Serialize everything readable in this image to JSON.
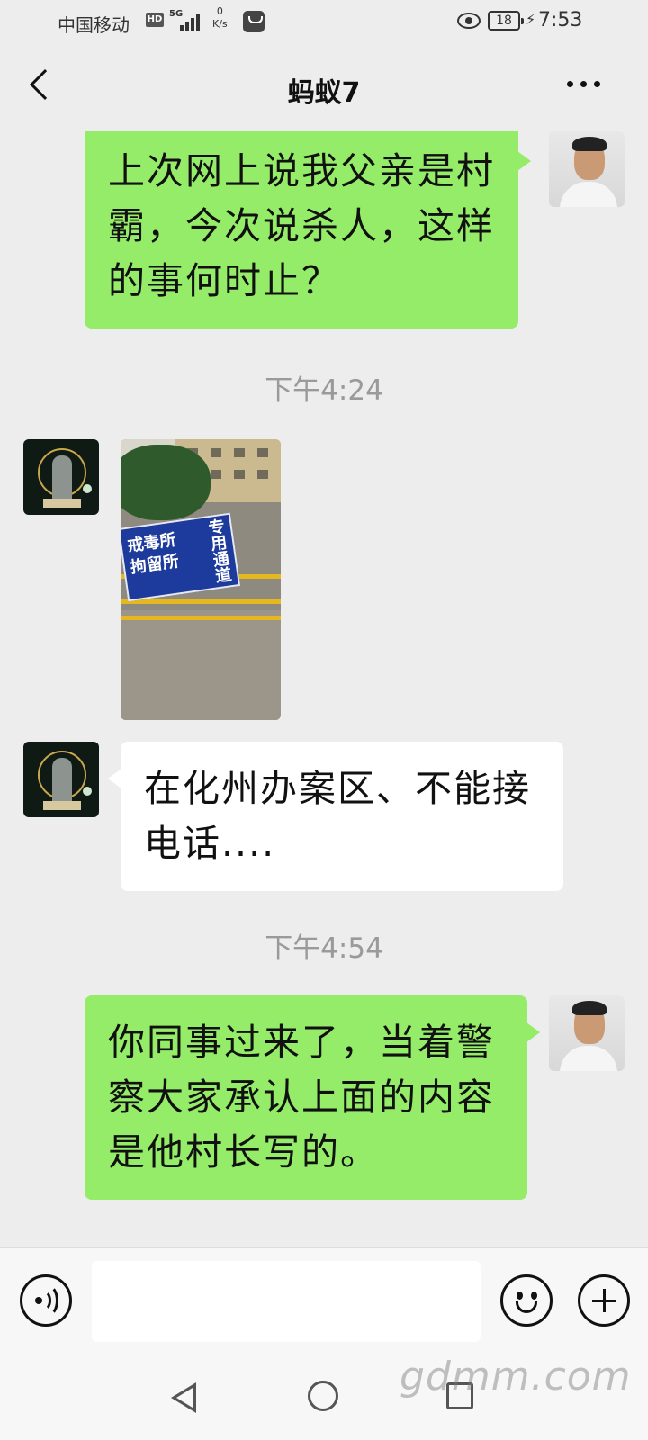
{
  "status_bar": {
    "carrier": "中国移动",
    "hd_badge": "HD",
    "network": "5G",
    "speed_value": "0",
    "speed_unit": "K/s",
    "battery_level": "18",
    "time": "7:53"
  },
  "navbar": {
    "title": "蚂蚁7",
    "back_icon": "chevron-left-icon",
    "more_icon": "more-dots-icon"
  },
  "messages": [
    {
      "side": "right",
      "type": "text",
      "text": "上次网上说我父亲是村霸，今次说杀人，这样的事何时止？"
    },
    {
      "type": "timestamp",
      "text": "下午4:24"
    },
    {
      "side": "left",
      "type": "image",
      "sign_text_1": "戒毒所",
      "sign_text_2": "拘留所",
      "sign_text_3": "专用通道"
    },
    {
      "side": "left",
      "type": "text",
      "text": "在化州办案区、不能接电话...."
    },
    {
      "type": "timestamp",
      "text": "下午4:54"
    },
    {
      "side": "right",
      "type": "text",
      "text": "你同事过来了，当着警察大家承认上面的内容是他村长写的。"
    }
  ],
  "input_bar": {
    "voice_icon": "voice-icon",
    "input_value": "",
    "emoji_icon": "emoji-icon",
    "plus_icon": "plus-icon"
  },
  "watermark": "gdmm.com",
  "colors": {
    "sent_bubble": "#95ec69",
    "received_bubble": "#ffffff",
    "background": "#ededed"
  }
}
